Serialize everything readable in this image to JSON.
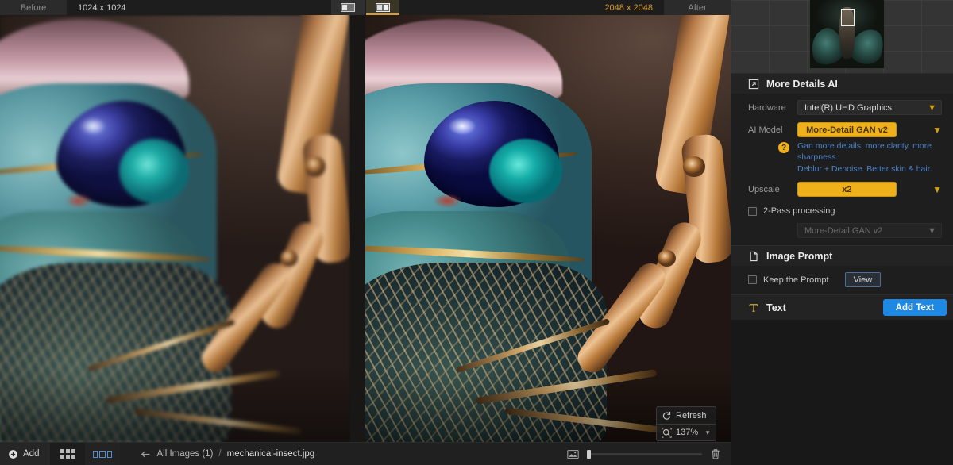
{
  "topbar": {
    "before_label": "Before",
    "before_dimensions": "1024 x 1024",
    "after_dimensions": "2048 x 2048",
    "after_label": "After",
    "view_single_icon": "single-pane-view-icon",
    "view_split_icon": "split-pane-view-icon",
    "active_view": "split"
  },
  "viewer": {
    "refresh_label": "Refresh",
    "refresh_icon": "refresh-icon",
    "zoom_level": "137%",
    "zoom_icon": "zoom-fit-icon",
    "zoom_chevron_icon": "chevron-down-icon"
  },
  "bottombar": {
    "add_label": "Add",
    "add_icon": "plus-circle-icon",
    "grid_view_icon": "grid-view-icon",
    "filmstrip_view_icon": "filmstrip-view-icon",
    "back_icon": "back-arrow-icon",
    "breadcrumb_root": "All Images (1)",
    "breadcrumb_separator": "/",
    "breadcrumb_file": "mechanical-insect.jpg",
    "thumbnail_size_icon": "thumbnail-size-icon",
    "thumbnail_slider_value": "0",
    "delete_icon": "trash-icon"
  },
  "panel": {
    "navigator": {
      "viewport_icon": "navigator-viewport"
    },
    "more_details": {
      "title": "More Details AI",
      "icon": "more-details-ai-icon",
      "hardware_label": "Hardware",
      "hardware_value": "Intel(R) UHD Graphics",
      "model_label": "AI Model",
      "model_value": "More-Detail GAN v2",
      "help_badge": "?",
      "help_line1": "Gan more details, more clarity, more sharpness.",
      "help_line2": "Deblur + Denoise. Better skin & hair.",
      "upscale_label": "Upscale",
      "upscale_value": "x2",
      "two_pass_label": "2-Pass processing",
      "two_pass_checked": false,
      "two_pass_model_value": "More-Detail GAN v2",
      "chevron_icon": "chevron-down-icon"
    },
    "image_prompt": {
      "title": "Image Prompt",
      "icon": "document-icon",
      "keep_prompt_label": "Keep the Prompt",
      "keep_prompt_checked": false,
      "view_button": "View"
    },
    "text": {
      "title": "Text",
      "icon": "text-tool-icon",
      "add_button": "Add Text"
    }
  },
  "colors": {
    "accent_amber": "#eeb11c",
    "accent_blue": "#1e88e5",
    "help_blue": "#4f82c4",
    "after_dim": "#d99a32",
    "panel_bg": "#181818"
  }
}
